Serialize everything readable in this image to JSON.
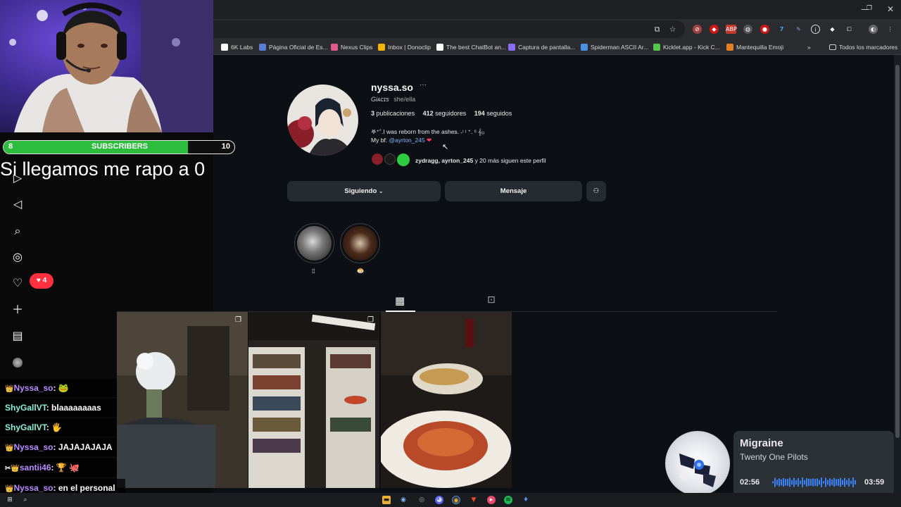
{
  "browser": {
    "bookmarks": [
      {
        "label": "6K Labs",
        "icon": "infinity-icon",
        "color": "#ffffff"
      },
      {
        "label": "Página Oficial de Es...",
        "icon": "shield-icon",
        "color": "#5b7bd5"
      },
      {
        "label": "Nexus Clips",
        "icon": "nexus-icon",
        "color": "#e05a8a"
      },
      {
        "label": "Inbox | Donoclip",
        "icon": "inbox-icon",
        "color": "#f5b400"
      },
      {
        "label": "The best ChatBot an...",
        "icon": "diamond-icon",
        "color": "#ffffff"
      },
      {
        "label": "Captura de pantalla...",
        "icon": "pen-icon",
        "color": "#8a6cf0"
      },
      {
        "label": "Spiderman ASCII Ar...",
        "icon": "plus-icon",
        "color": "#4a90e2"
      },
      {
        "label": "Kicklet.app - Kick C...",
        "icon": "kicklet-icon",
        "color": "#53c64a"
      },
      {
        "label": "Mantequilla Emoji",
        "icon": "butter-icon",
        "color": "#e67e22"
      }
    ],
    "all_bookmarks_label": "Todos los marcadores",
    "more_label": "»"
  },
  "profile": {
    "username": "nyssa.so",
    "more_label": "···",
    "display_name": "Giᴀᴄɪs",
    "pronouns": "she/ella",
    "posts_count": "3",
    "posts_label": "publicaciones",
    "followers_count": "412",
    "followers_label": "seguidores",
    "following_count": "194",
    "following_label": "seguidos",
    "bio_line1": "𖤐⁺˚.I was reborn from the ashes. ˖ᵎ ᵎ ⁺. ᶜ 𝄞₍₎",
    "bio_prefix": "My bf: ",
    "bio_mention": "@ayrton_245",
    "followed_by_names": "zydragg, ayrton_245",
    "followed_by_suffix": " y 20 más siguen este perfil",
    "following_button": "Siguiendo",
    "message_button": "Mensaje",
    "highlights": [
      {
        "label": "▯"
      },
      {
        "label": "🍮"
      }
    ]
  },
  "stream": {
    "subs_current": "8",
    "subs_label": "SUBSCRIBERS",
    "subs_goal": "10",
    "subs_progress": 0.8,
    "goal_text": "Si llegamos me rapo a 0",
    "notifications_count": "4",
    "chat": [
      {
        "badge": "👑",
        "user": "Nyssa_so",
        "color": "#b98cff",
        "message": "🐸"
      },
      {
        "badge": "",
        "user": "ShyGallVT",
        "color": "#8cf0d8",
        "message": "blaaaaaaaas"
      },
      {
        "badge": "",
        "user": "ShyGallVT",
        "color": "#8cf0d8",
        "message": "🖐"
      },
      {
        "badge": "👑",
        "user": "Nyssa_so",
        "color": "#b98cff",
        "message": "JAJAJAJAJA"
      },
      {
        "badge": "✂👑",
        "user": "santii46",
        "color": "#b98cff",
        "message": "🏆 🐙"
      },
      {
        "badge": "👑",
        "user": "Nyssa_so",
        "color": "#b98cff",
        "message": "en el personal"
      }
    ]
  },
  "now_playing": {
    "title": "Migraine",
    "artist": "Twenty One Pilots",
    "elapsed": "02:56",
    "duration": "03:59",
    "progress": 0.74
  },
  "colors": {
    "accent_link": "#e0f1ff",
    "mention": "#8cb4ff",
    "sub_green": "#2bbd3b",
    "notification_red": "#ff3040"
  }
}
